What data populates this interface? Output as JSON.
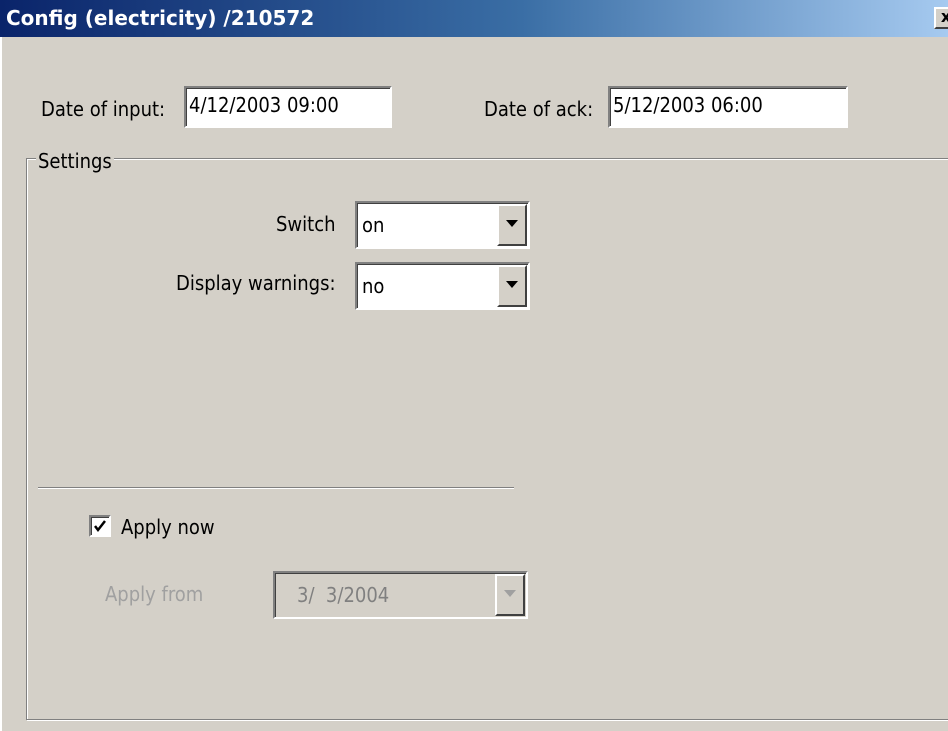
{
  "window": {
    "title": "Config (electricity) /210572",
    "close_glyph": "x"
  },
  "header": {
    "date_input_label": "Date of input:",
    "date_input_value": "4/12/2003 09:00",
    "date_ack_label": "Date of ack:",
    "date_ack_value": "5/12/2003 06:00"
  },
  "settings": {
    "legend": "Settings",
    "switch_label": "Switch",
    "switch_value": "on",
    "warnings_label": "Display warnings:",
    "warnings_value": "no"
  },
  "apply": {
    "apply_now_label": "Apply now",
    "apply_now_checked": true,
    "apply_from_label": "Apply from",
    "apply_from_value": "3/  3/2004"
  },
  "icons": {
    "dropdown": "chevron-down-icon",
    "check": "check-icon",
    "close": "close-icon"
  },
  "colors": {
    "titlebar_start": "#0a246a",
    "titlebar_end": "#a6caf0",
    "face": "#d4d0c8"
  }
}
